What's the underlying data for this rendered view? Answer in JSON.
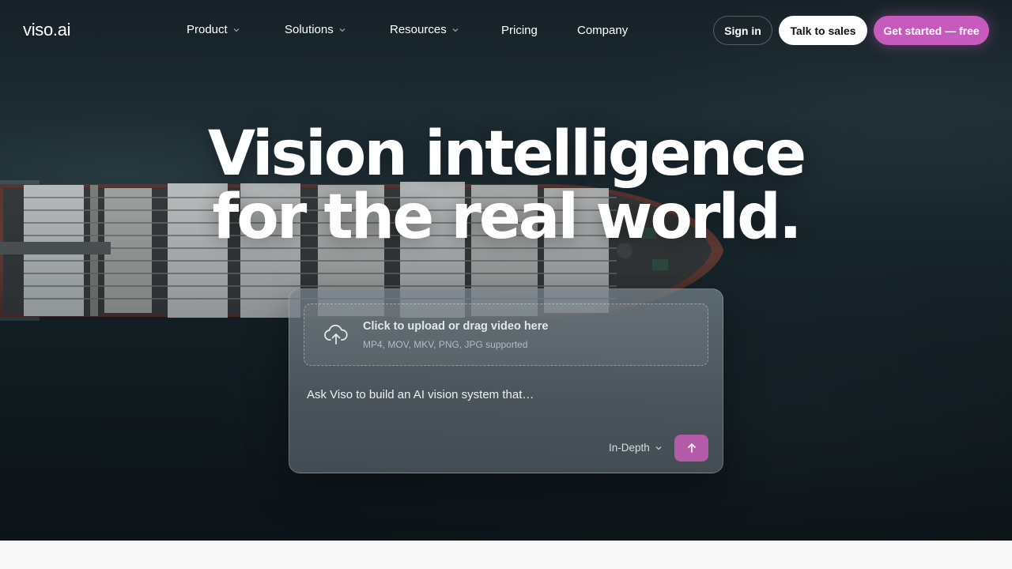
{
  "brand": {
    "logo_text": "viso.ai"
  },
  "nav": {
    "items": [
      {
        "label": "Product",
        "dropdown": true
      },
      {
        "label": "Solutions",
        "dropdown": true
      },
      {
        "label": "Resources",
        "dropdown": true
      },
      {
        "label": "Pricing",
        "dropdown": false
      },
      {
        "label": "Company",
        "dropdown": false
      }
    ]
  },
  "header_actions": {
    "sign_in": "Sign in",
    "talk_to_sales": "Talk to sales",
    "get_started": "Get started — free"
  },
  "hero": {
    "headline_line1": "Vision intelligence",
    "headline_line2": "for the real world."
  },
  "prompt_card": {
    "upload_title": "Click to upload or drag video here",
    "upload_formats": "MP4, MOV, MKV, PNG, JPG supported",
    "prompt_placeholder": "Ask Viso to build an AI vision system that…",
    "mode_selected": "In-Depth",
    "icons": {
      "upload": "cloud-upload-icon",
      "send": "arrow-up-icon",
      "mode": "chevron-down-icon"
    }
  },
  "colors": {
    "accent": "#c65bbd",
    "send_button": "#b65aaa",
    "background_dark": "#1b2a31"
  }
}
